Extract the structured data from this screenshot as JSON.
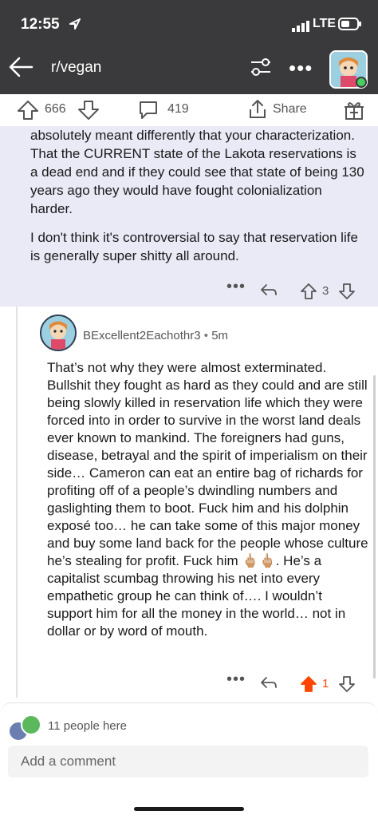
{
  "status_bar": {
    "time": "12:55",
    "network": "LTE"
  },
  "header": {
    "subreddit": "r/vegan"
  },
  "post_actions": {
    "score": "666",
    "comments": "419",
    "share_label": "Share"
  },
  "parent_comment": {
    "paragraphs": [
      "absolutely meant differently that your characterization. That the CURRENT state of the Lakota reservations is a dead end and if they could see that state of being 130 years ago they would have fought colonialization harder.",
      "I don't think it's controversial to say that reservation life is generally super shitty all around."
    ],
    "more": "•••",
    "score": "3"
  },
  "reply_comment": {
    "author": "BExcellent2Eachothr3",
    "separator": "•",
    "age": "5m",
    "body": "That’s not why they were almost exterminated. Bullshit they fought as hard as they could and are still being slowly killed in reservation life which they were forced into in order to survive in the worst land deals ever known to mankind. The foreigners had guns, disease, betrayal and the spirit of imperialism on their side… Cameron can eat an entire bag of richards for profiting off of a people’s dwindling numbers and gaslighting them to boot. Fuck him and his dolphin exposé too… he can take some of this major money and buy some land back for the people whose culture he’s stealing for profit. Fuck him 🖕🏼🖕🏼. He’s a capitalist scumbag throwing his net into every empathetic group he can think of…. I wouldn’t support him for all the money in the world… not in dollar or by word of mouth.",
    "more": "•••",
    "score": "1",
    "upvoted_color": "#ff4500"
  },
  "bottom": {
    "people_here": "11 people here",
    "comment_placeholder": "Add a comment"
  },
  "colors": {
    "header_bg": "#3a3a3c",
    "parent_bg": "#e9eaf6",
    "upvote": "#ff4500"
  }
}
